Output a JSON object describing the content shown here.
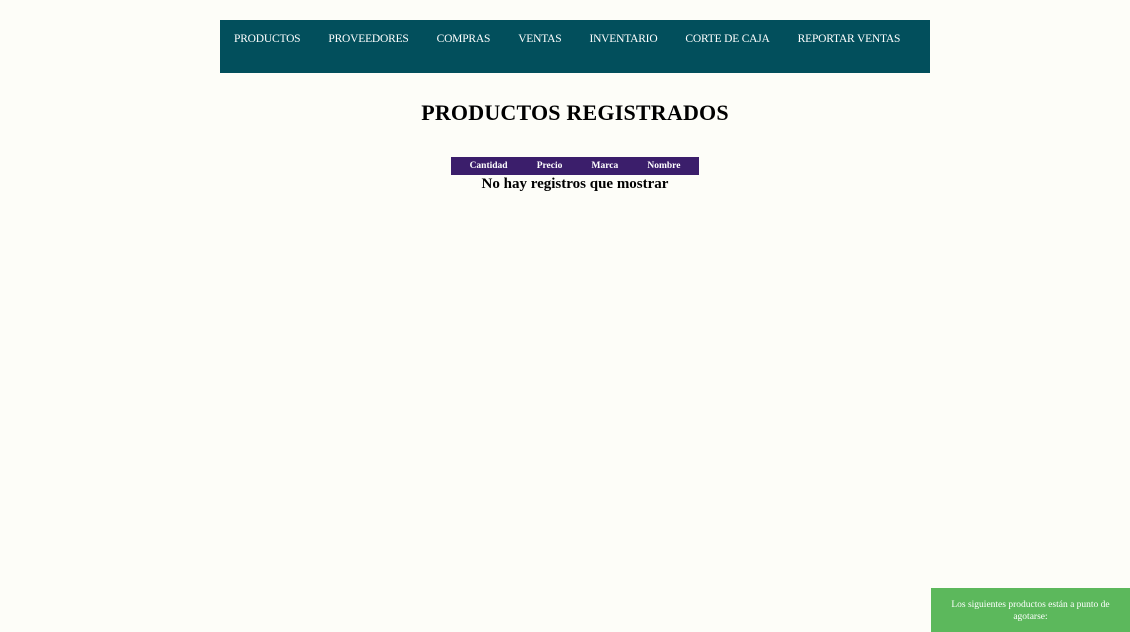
{
  "nav": {
    "items": [
      {
        "label": "PRODUCTOS"
      },
      {
        "label": "PROVEEDORES"
      },
      {
        "label": "COMPRAS"
      },
      {
        "label": "VENTAS"
      },
      {
        "label": "INVENTARIO"
      },
      {
        "label": "CORTE DE CAJA"
      },
      {
        "label": "REPORTAR VENTAS"
      }
    ]
  },
  "main": {
    "title": "PRODUCTOS REGISTRADOS",
    "table": {
      "columns": [
        "Cantidad",
        "Precio",
        "Marca",
        "Nombre"
      ],
      "rows": [],
      "empty_message": "No hay registros que mostrar"
    }
  },
  "toast": {
    "message": "Los siguientes productos están a punto de agotarse:"
  },
  "colors": {
    "navbar_bg": "#024f5c",
    "table_header_bg": "#3b1e6b",
    "toast_bg": "#5cb85c",
    "page_bg": "#fdfdf8"
  }
}
